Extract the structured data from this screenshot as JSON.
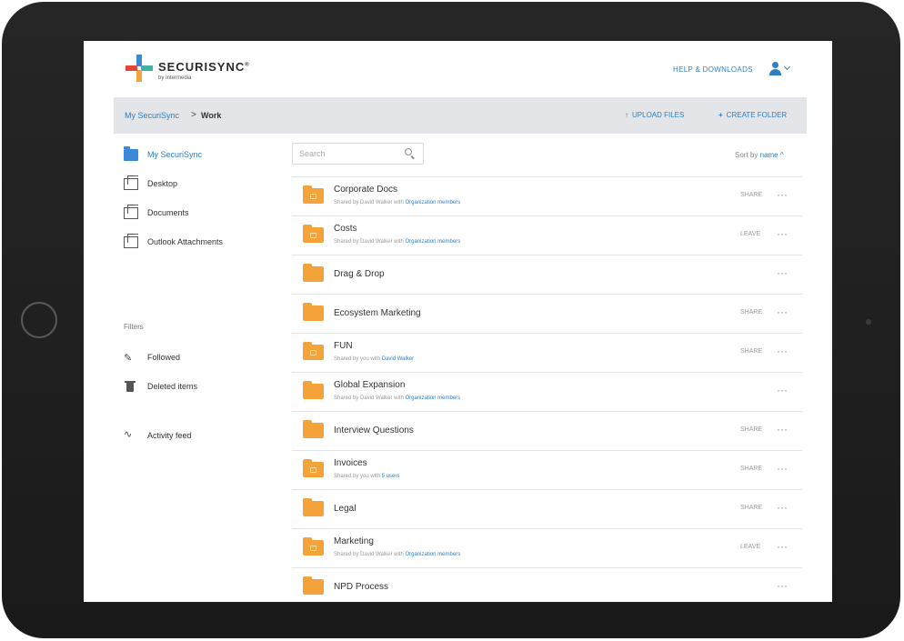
{
  "brand": {
    "name": "SECURISYNC",
    "mark": "®",
    "sub": "by Intermedia",
    "colors": {
      "blue": "#2d7fc1",
      "red": "#e64637",
      "orange": "#f4a23a",
      "teal": "#3fb39f"
    }
  },
  "header": {
    "help": "HELP & DOWNLOADS",
    "user_icon": "user-icon"
  },
  "breadcrumb": {
    "root": "My SecuriSync",
    "sep": ">",
    "current": "Work"
  },
  "actions": {
    "upload": "UPLOAD FILES",
    "create": "CREATE FOLDER"
  },
  "sidebar": {
    "items": [
      {
        "label": "My SecuriSync",
        "icon": "folder-icon"
      },
      {
        "label": "Desktop",
        "icon": "computer-icon"
      },
      {
        "label": "Documents",
        "icon": "documents-icon"
      },
      {
        "label": "Outlook Attachments",
        "icon": "attachments-icon"
      }
    ],
    "filters_label": "Filters",
    "filters": [
      {
        "label": "Followed",
        "icon": "pin-icon"
      },
      {
        "label": "Deleted items",
        "icon": "trash-icon"
      }
    ],
    "activity": {
      "label": "Activity feed",
      "icon": "activity-icon"
    }
  },
  "search": {
    "placeholder": "Search"
  },
  "sort": {
    "label": "Sort by",
    "value": "name",
    "arrow": "^"
  },
  "rows": [
    {
      "name": "Corporate Docs",
      "sub_prefix": "Shared by David Walker with ",
      "sub_who": "Organization members",
      "share": "SHARE",
      "more": "···"
    },
    {
      "name": "Costs",
      "sub_prefix": "Shared by David Walker with ",
      "sub_who": "Organization members",
      "share": "LEAVE",
      "more": "···"
    },
    {
      "name": "Drag & Drop",
      "sub_prefix": "",
      "sub_who": "",
      "share": "",
      "more": "···"
    },
    {
      "name": "Ecosystem Marketing",
      "sub_prefix": "",
      "sub_who": "",
      "share": "SHARE",
      "more": "···"
    },
    {
      "name": "FUN",
      "sub_prefix": "Shared by you with ",
      "sub_who": "David Walker",
      "share": "SHARE",
      "more": "···"
    },
    {
      "name": "Global Expansion",
      "sub_prefix": "Shared by David Walker with ",
      "sub_who": "Organization members",
      "share": "",
      "more": "···"
    },
    {
      "name": "Interview Questions",
      "sub_prefix": "",
      "sub_who": "",
      "share": "SHARE",
      "more": "···"
    },
    {
      "name": "Invoices",
      "sub_prefix": "Shared by you with ",
      "sub_who": "5 users",
      "share": "SHARE",
      "more": "···"
    },
    {
      "name": "Legal",
      "sub_prefix": "",
      "sub_who": "",
      "share": "SHARE",
      "more": "···"
    },
    {
      "name": "Marketing",
      "sub_prefix": "Shared by David Walker with ",
      "sub_who": "Organization members",
      "share": "LEAVE",
      "more": "···"
    },
    {
      "name": "NPD Process",
      "sub_prefix": "",
      "sub_who": "",
      "share": "",
      "more": "···"
    }
  ]
}
